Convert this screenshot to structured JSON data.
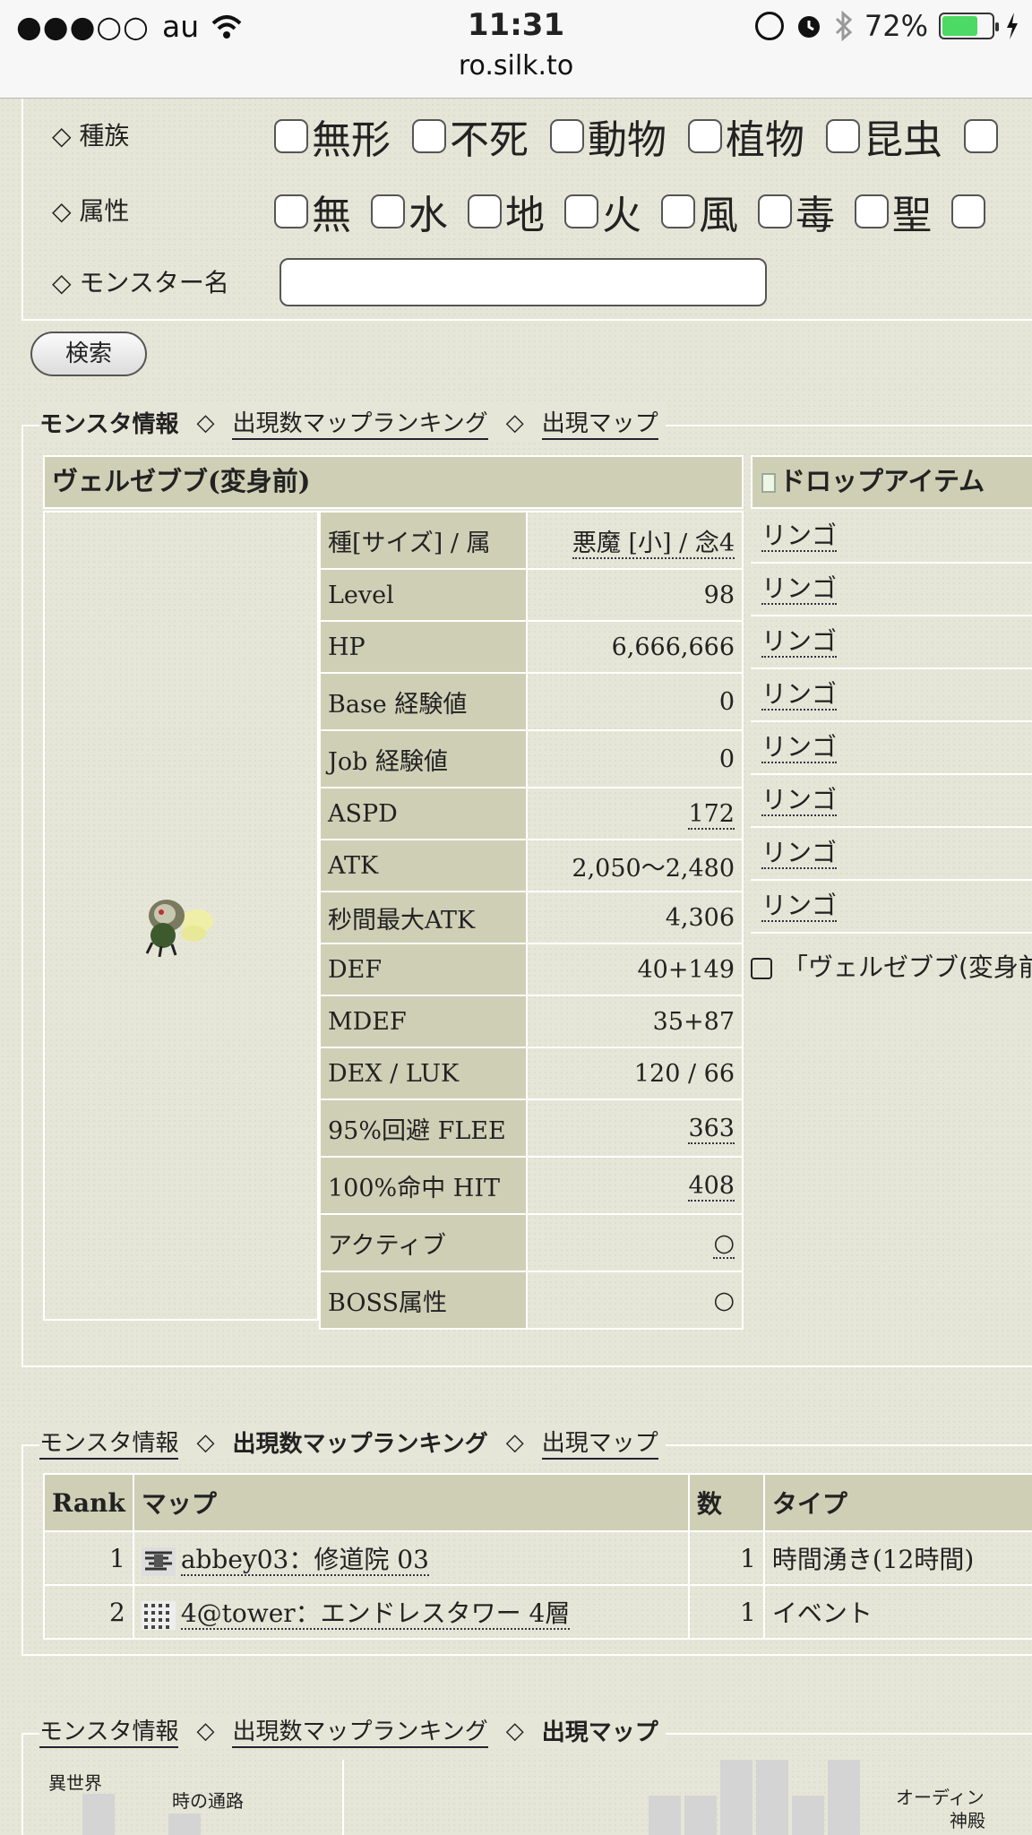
{
  "status_bar": {
    "signal": "●●●○○",
    "carrier": "au",
    "time": "11:31",
    "url": "ro.silk.to",
    "battery": "72%",
    "battery_level": 0.72
  },
  "search": {
    "race_label": "◇ 種族",
    "races": [
      "無形",
      "不死",
      "動物",
      "植物",
      "昆虫"
    ],
    "element_label": "◇ 属性",
    "elements": [
      "無",
      "水",
      "地",
      "火",
      "風",
      "毒",
      "聖"
    ],
    "name_label": "◇ モンスター名",
    "name_value": "",
    "button": "検索"
  },
  "tabs": {
    "info": "モンスタ情報",
    "ranking": "出現数マップランキング",
    "map": "出現マップ",
    "diamond": "◇"
  },
  "monster": {
    "name": "ヴェルゼブブ(変身前)",
    "stats": [
      {
        "key": "種[サイズ] / 属",
        "value": "悪魔 [小] / 念4"
      },
      {
        "key": "Level",
        "value": "98"
      },
      {
        "key": "HP",
        "value": "6,666,666"
      },
      {
        "key": "Base 経験値",
        "value": "0"
      },
      {
        "key": "Job 経験値",
        "value": "0"
      },
      {
        "key": "ASPD",
        "value": "172"
      },
      {
        "key": "ATK",
        "value": "2,050〜2,480"
      },
      {
        "key": "秒間最大ATK",
        "value": "4,306"
      },
      {
        "key": "DEF",
        "value": "40+149"
      },
      {
        "key": "MDEF",
        "value": "35+87"
      },
      {
        "key": "DEX / LUK",
        "value": "120 / 66"
      },
      {
        "key": "95%回避 FLEE",
        "value": "363"
      },
      {
        "key": "100%命中 HIT",
        "value": "408"
      },
      {
        "key": "アクティブ",
        "value": "○"
      },
      {
        "key": "BOSS属性",
        "value": "○"
      }
    ]
  },
  "drops": {
    "header": "ドロップアイテム",
    "items": [
      "リンゴ",
      "リンゴ",
      "リンゴ",
      "リンゴ",
      "リンゴ",
      "リンゴ",
      "リンゴ",
      "リンゴ"
    ],
    "note": "「ヴェルゼブブ(変身前"
  },
  "ranking": {
    "headers": [
      "Rank",
      "マップ",
      "数",
      "タイプ"
    ],
    "rows": [
      {
        "rank": "1",
        "map": "abbey03：修道院 03",
        "count": "1",
        "type": "時間湧き(12時間)"
      },
      {
        "rank": "2",
        "map": "4@tower：エンドレスタワー 4層",
        "count": "1",
        "type": "イベント"
      }
    ]
  },
  "map_labels": {
    "a": "異世界",
    "b": "時の通路",
    "c": "オーディン",
    "d": "神殿"
  }
}
